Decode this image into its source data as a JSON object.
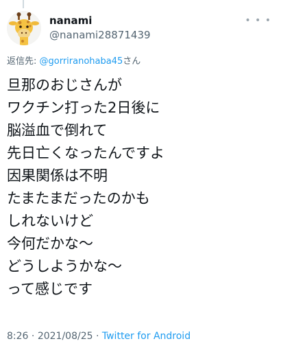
{
  "tweet": {
    "author": {
      "name": "nanami",
      "handle": "@nanami28871439",
      "avatar_icon": "giraffe-icon"
    },
    "more_icon": "more-options-icon",
    "reply_to": {
      "prefix": "返信先: ",
      "mention": "@gorriranohaba45",
      "suffix": "さん"
    },
    "lines": [
      "旦那のおじさんが",
      "ワクチン打った2日後に",
      "脳溢血で倒れて",
      "先日亡くなったんですよ",
      "因果関係は不明",
      "たまたまだったのかも",
      "しれないけど",
      "今何だかな〜",
      "どうしようかな〜",
      "って感じです"
    ],
    "meta": {
      "time": "8:26",
      "separator": " · ",
      "date": "2021/08/25",
      "source": "Twitter for Android"
    }
  },
  "colors": {
    "text": "#0f1419",
    "secondary": "#536471",
    "link": "#1d9bf0"
  }
}
